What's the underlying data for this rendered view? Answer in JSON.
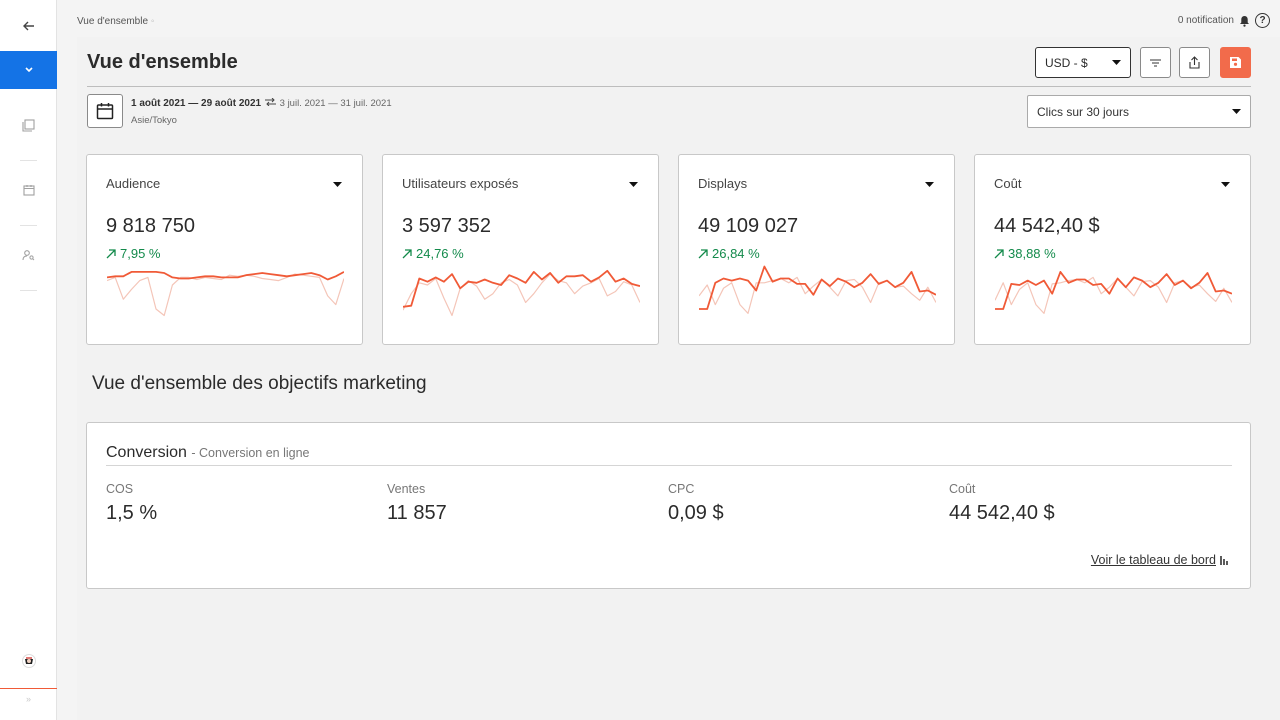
{
  "sidebar": {
    "items": [
      {
        "icon": "arrow-left-icon"
      },
      {
        "icon": "chevron-down-icon"
      },
      {
        "icon": "copy-icon"
      },
      {
        "icon": "calendar-icon"
      },
      {
        "icon": "user-search-icon"
      },
      {
        "icon": "avatar-icon"
      }
    ],
    "footer": "»"
  },
  "topbar": {
    "breadcrumb": "Vue d'ensemble",
    "notifications": "0 notification"
  },
  "header": {
    "title": "Vue d'ensemble",
    "currency": "USD - $",
    "filter_icon": "filter-icon",
    "share_icon": "share-icon",
    "save_icon": "save-icon"
  },
  "daterange": {
    "primary": "1 août 2021 — 29 août 2021",
    "compare": "3 juil. 2021 — 31 juil. 2021",
    "timezone": "Asie/Tokyo",
    "period": "Clics sur 30 jours"
  },
  "kpis": [
    {
      "label": "Audience",
      "value": "9 818 750",
      "delta": "7,95 %",
      "series_current": [
        55,
        54,
        54,
        50,
        50,
        50,
        50,
        51,
        55,
        56,
        56,
        55,
        54,
        54,
        55,
        55,
        55,
        53,
        52,
        51,
        52,
        53,
        54,
        53,
        52,
        51,
        53,
        57,
        54,
        50
      ],
      "series_previous": [
        58,
        55,
        75,
        66,
        58,
        55,
        84,
        90,
        62,
        55,
        55,
        57,
        55,
        56,
        57,
        53,
        54,
        53,
        54,
        56,
        57,
        58,
        55,
        52,
        53,
        54,
        55,
        72,
        80,
        56
      ]
    },
    {
      "label": "Utilisateurs exposés",
      "value": "3 597 352",
      "delta": "24,76 %",
      "series_current": [
        82,
        81,
        56,
        59,
        55,
        59,
        52,
        65,
        59,
        60,
        57,
        60,
        62,
        53,
        56,
        60,
        50,
        57,
        51,
        60,
        54,
        54,
        53,
        59,
        55,
        49,
        59,
        56,
        61,
        63
      ],
      "series_previous": [
        85,
        70,
        60,
        62,
        56,
        74,
        90,
        65,
        58,
        63,
        75,
        70,
        60,
        57,
        62,
        78,
        70,
        60,
        52,
        58,
        60,
        70,
        63,
        60,
        56,
        72,
        68,
        59,
        62,
        78
      ]
    },
    {
      "label": "Displays",
      "value": "49 109 027",
      "delta": "26,84 %",
      "series_current": [
        84,
        84,
        60,
        56,
        58,
        56,
        58,
        67,
        45,
        59,
        56,
        56,
        61,
        61,
        71,
        57,
        63,
        56,
        59,
        64,
        60,
        52,
        61,
        58,
        64,
        60,
        50,
        68,
        67,
        71
      ],
      "series_previous": [
        72,
        62,
        80,
        65,
        60,
        80,
        88,
        60,
        60,
        58,
        56,
        60,
        55,
        70,
        63,
        57,
        64,
        72,
        58,
        57,
        64,
        78,
        60,
        58,
        64,
        63,
        70,
        76,
        64,
        78
      ]
    },
    {
      "label": "Coût",
      "value": "44 542,40 $",
      "delta": "38,88 %",
      "series_current": [
        84,
        84,
        61,
        62,
        58,
        62,
        58,
        70,
        50,
        60,
        57,
        57,
        62,
        61,
        70,
        56,
        64,
        55,
        58,
        64,
        60,
        52,
        62,
        58,
        65,
        60,
        51,
        68,
        67,
        70
      ],
      "series_previous": [
        76,
        60,
        80,
        66,
        60,
        80,
        88,
        61,
        60,
        58,
        57,
        60,
        55,
        70,
        64,
        56,
        64,
        72,
        59,
        58,
        64,
        78,
        60,
        58,
        64,
        62,
        70,
        77,
        65,
        78
      ]
    }
  ],
  "section": {
    "title": "Vue d'ensemble des objectifs marketing"
  },
  "conversion": {
    "title": "Conversion",
    "subtitle": "- Conversion en ligne",
    "metrics": [
      {
        "label": "COS",
        "value": "1,5 %"
      },
      {
        "label": "Ventes",
        "value": "11 857"
      },
      {
        "label": "CPC",
        "value": "0,09 $"
      },
      {
        "label": "Coût",
        "value": "44 542,40 $"
      }
    ],
    "link": "Voir le tableau de bord"
  },
  "colors": {
    "accent": "#1473e6",
    "series_current": "#f05a37",
    "series_previous": "#f4c5b8",
    "positive": "#138a4b",
    "save": "#f26b4b"
  }
}
